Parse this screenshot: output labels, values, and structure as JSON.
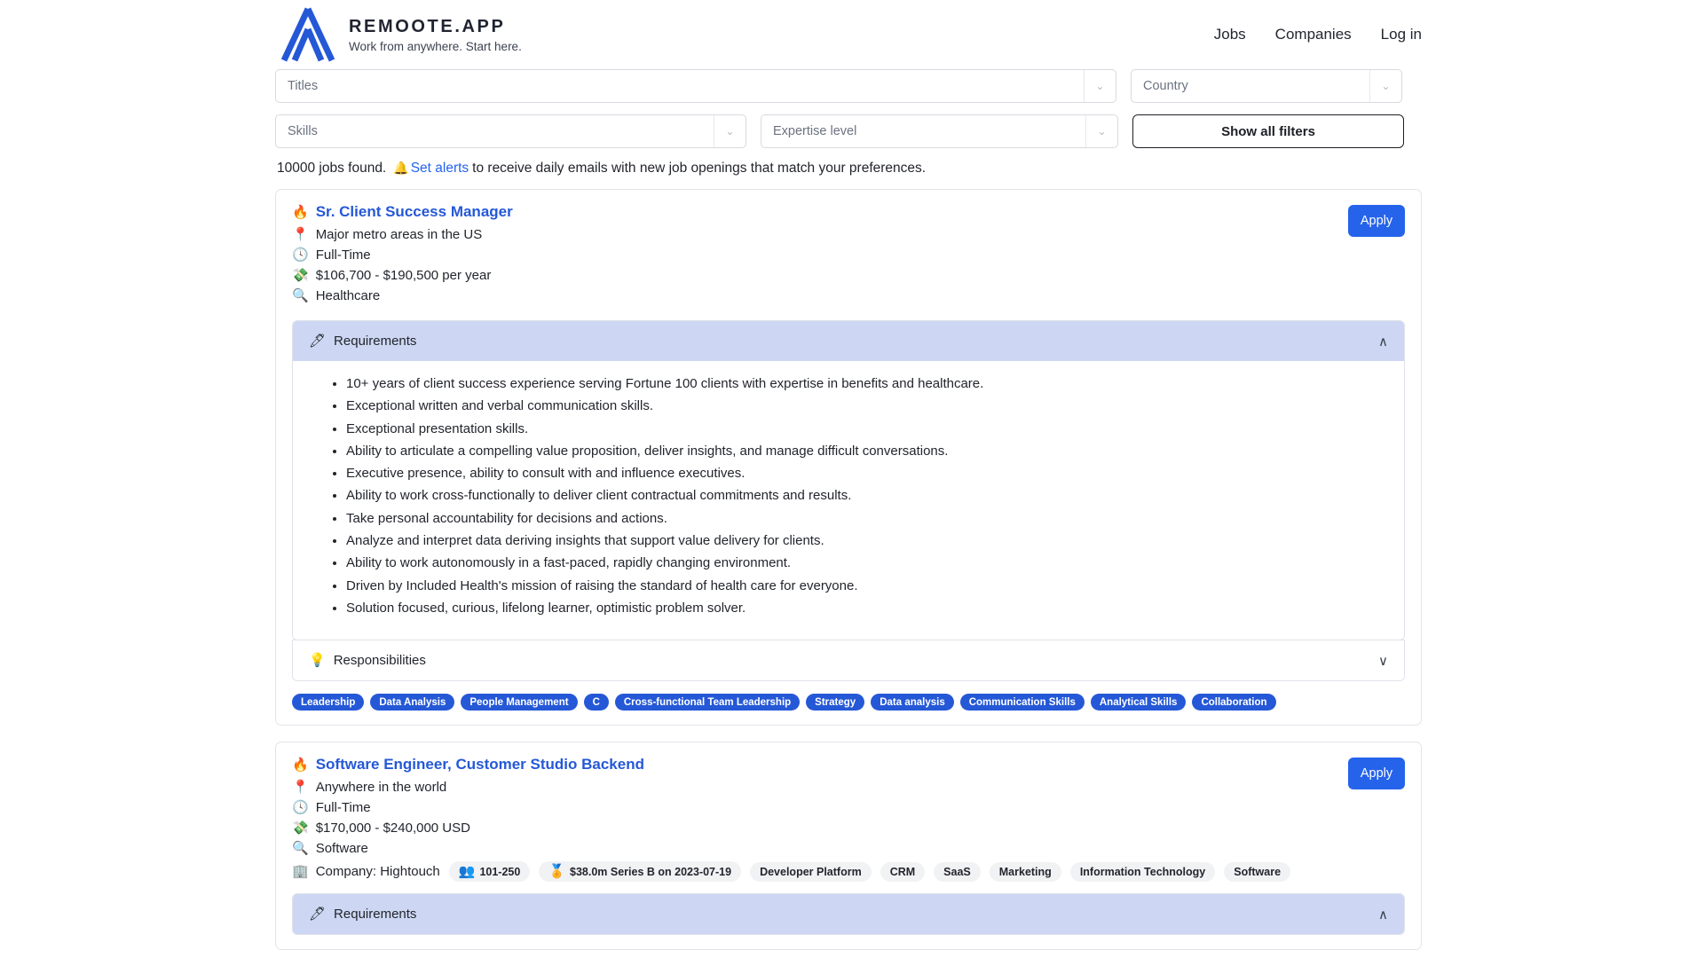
{
  "brand": {
    "title": "REMOOTE.APP",
    "tagline": "Work from anywhere. Start here.",
    "logo_color": "#2558d6"
  },
  "nav": {
    "items": [
      "Jobs",
      "Companies",
      "Log in"
    ]
  },
  "filters": {
    "titles_placeholder": "Titles",
    "country_placeholder": "Country",
    "skills_placeholder": "Skills",
    "expertise_placeholder": "Expertise level",
    "show_all_label": "Show all filters",
    "caret": "⌄"
  },
  "results": {
    "count_text": "10000 jobs found.",
    "bell_icon": "🔔",
    "alerts_link": "Set alerts",
    "suffix": "to receive daily emails with new job openings that match your preferences."
  },
  "icons": {
    "fire": "🔥",
    "pin": "📍",
    "clock": "🕓",
    "money": "💸",
    "magnifier": "🔍",
    "pen": "🖊",
    "bulb": "💡",
    "building": "🏢",
    "people": "👥",
    "medal": "🏅",
    "chevron_up": "∧",
    "chevron_down": "∨"
  },
  "apply_label": "Apply",
  "section_labels": {
    "requirements": "Requirements",
    "responsibilities": "Responsibilities"
  },
  "jobs": [
    {
      "title": "Sr. Client Success Manager",
      "location": "Major metro areas in the US",
      "type": "Full-Time",
      "salary": "$106,700 - $190,500 per year",
      "category": "Healthcare",
      "requirements": [
        "10+ years of client success experience serving Fortune 100 clients with expertise in benefits and healthcare.",
        "Exceptional written and verbal communication skills.",
        "Exceptional presentation skills.",
        "Ability to articulate a compelling value proposition, deliver insights, and manage difficult conversations.",
        "Executive presence, ability to consult with and influence executives.",
        "Ability to work cross-functionally to deliver client contractual commitments and results.",
        "Take personal accountability for decisions and actions.",
        "Analyze and interpret data deriving insights that support value delivery for clients.",
        "Ability to work autonomously in a fast-paced, rapidly changing environment.",
        "Driven by Included Health's mission of raising the standard of health care for everyone.",
        "Solution focused, curious, lifelong learner, optimistic problem solver."
      ],
      "tags": [
        "Leadership",
        "Data Analysis",
        "People Management",
        "C",
        "Cross-functional Team Leadership",
        "Strategy",
        "Data analysis",
        "Communication Skills",
        "Analytical Skills",
        "Collaboration"
      ]
    },
    {
      "title": "Software Engineer, Customer Studio Backend",
      "location": "Anywhere in the world",
      "type": "Full-Time",
      "salary": "$170,000 - $240,000 USD",
      "category": "Software",
      "company_label": "Company: Hightouch",
      "headcount": "101-250",
      "funding": "$38.0m Series B on 2023-07-19",
      "industry_chips": [
        "Developer Platform",
        "CRM",
        "SaaS",
        "Marketing",
        "Information Technology",
        "Software"
      ]
    }
  ]
}
